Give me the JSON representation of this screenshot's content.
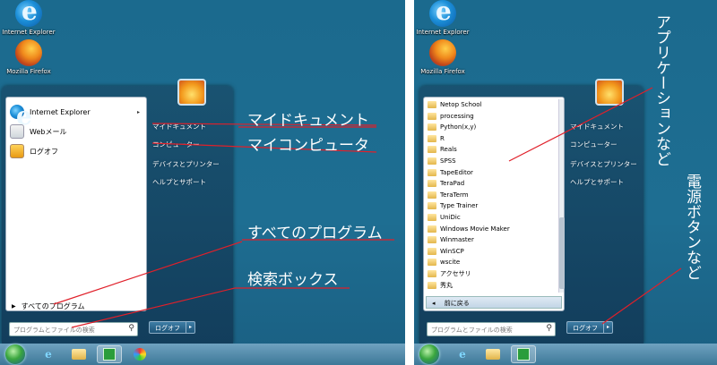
{
  "desktop_icons": {
    "ie_label": "Internet Explorer",
    "firefox_label": "Mozilla Firefox"
  },
  "left_menu": {
    "programs": [
      {
        "label": "Internet Explorer",
        "has_submenu": "▸"
      },
      {
        "label": "Webメール"
      },
      {
        "label": "ログオフ"
      }
    ],
    "all_programs": "すべてのプログラム",
    "search_placeholder": "プログラムとファイルの検索",
    "right_items": [
      "マイドキュメント",
      "コンピューター",
      "デバイスとプリンター",
      "ヘルプとサポート"
    ],
    "shutdown_label": "ログオフ"
  },
  "right_menu": {
    "programs": [
      "Netop School",
      "processing",
      "Python(x,y)",
      "R",
      "Reals",
      "SPSS",
      "TapeEditor",
      "TeraPad",
      "TeraTerm",
      "Type Trainer",
      "UniDic",
      "Windows Movie Maker",
      "Winmaster",
      "WinSCP",
      "wscite",
      "アクセサリ",
      "秀丸"
    ],
    "back_label": "前に戻る",
    "search_placeholder": "プログラムとファイルの検索",
    "right_items": [
      "マイドキュメント",
      "コンピューター",
      "デバイスとプリンター",
      "ヘルプとサポート"
    ],
    "shutdown_label": "ログオフ"
  },
  "annotations": {
    "my_documents": "マイドキュメント",
    "my_computer": "マイコンピュータ",
    "all_programs": "すべてのプログラム",
    "search_box": "検索ボックス",
    "applications": "アプリケーションなど",
    "power_button": "電源ボタンなど"
  },
  "colors": {
    "desktop": "#1e6e92",
    "annotation_line": "#e0202a"
  }
}
